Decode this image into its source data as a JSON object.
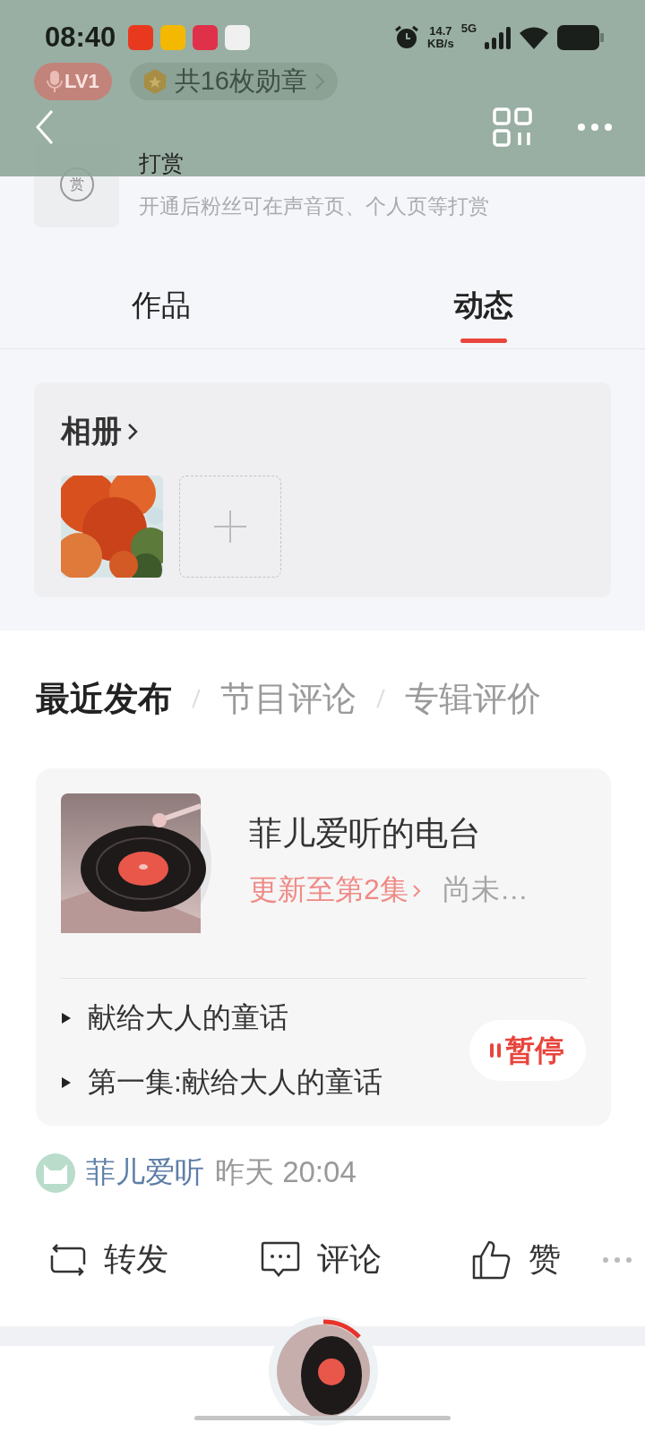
{
  "status_bar": {
    "time": "08:40",
    "notifications": [
      {
        "color": "#e8391f"
      },
      {
        "color": "#f5b800"
      },
      {
        "color": "#e0314b"
      },
      {
        "color": "#f0f0f0"
      }
    ],
    "speed": "14.7",
    "speed_unit": "KB/s",
    "network": "5G"
  },
  "profile": {
    "level_badge": "LV1",
    "medals": "共16枚勋章"
  },
  "tip": {
    "icon_glyph": "赏",
    "title": "打赏",
    "subtitle": "开通后粉丝可在声音页、个人页等打赏"
  },
  "tabs": [
    {
      "label": "作品",
      "selected": false
    },
    {
      "label": "动态",
      "selected": true
    }
  ],
  "album": {
    "title": "相册"
  },
  "feed_filters": [
    {
      "label": "最近发布",
      "selected": true
    },
    {
      "label": "节目评论",
      "selected": false
    },
    {
      "label": "专辑评价",
      "selected": false
    }
  ],
  "post": {
    "radio": {
      "title": "菲儿爱听的电台",
      "update": "更新至第2集",
      "status": "尚未…",
      "tracks": [
        "献给大人的童话",
        "第一集:献给大人的童话"
      ],
      "playing": true,
      "button": "暂停"
    },
    "author": "菲儿爱听",
    "time": "昨天 20:04",
    "actions": [
      {
        "kind": "repost",
        "label": "转发"
      },
      {
        "kind": "comment",
        "label": "评论"
      },
      {
        "kind": "like",
        "label": "赞"
      }
    ]
  }
}
